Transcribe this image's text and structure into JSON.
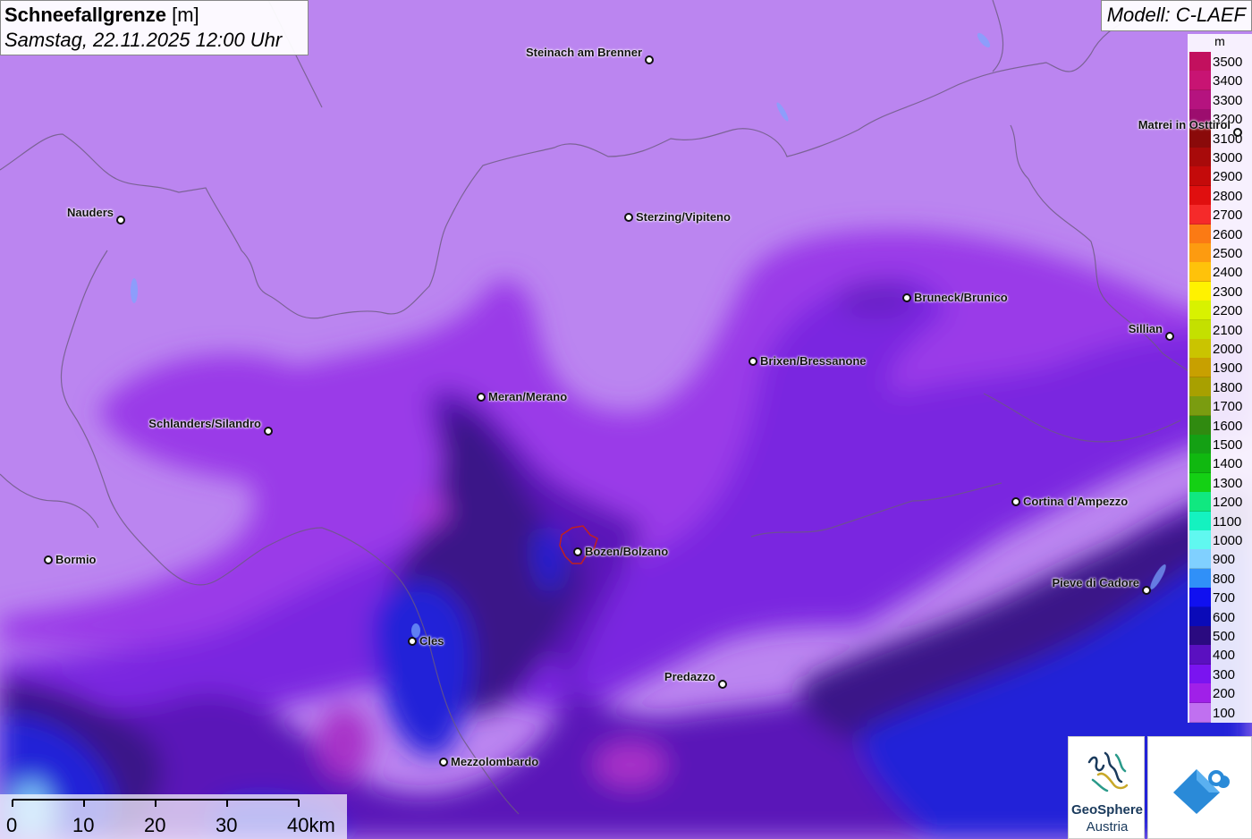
{
  "title": {
    "main": "Schneefallgrenze",
    "unit": "[m]",
    "subtitle": "Samstag, 22.11.2025 12:00 Uhr"
  },
  "model": "Modell: C-LAEF",
  "legend": {
    "unit": "m",
    "items": [
      {
        "label": "3500",
        "color": "#c2105e"
      },
      {
        "label": "3400",
        "color": "#c81473"
      },
      {
        "label": "3300",
        "color": "#b5137f"
      },
      {
        "label": "3200",
        "color": "#9c0d6e"
      },
      {
        "label": "3100",
        "color": "#8a0a0a"
      },
      {
        "label": "3000",
        "color": "#a80a0a"
      },
      {
        "label": "2900",
        "color": "#c40a0a"
      },
      {
        "label": "2800",
        "color": "#e00f0f"
      },
      {
        "label": "2700",
        "color": "#f52a2a"
      },
      {
        "label": "2600",
        "color": "#fb7a14"
      },
      {
        "label": "2500",
        "color": "#fd9b10"
      },
      {
        "label": "2400",
        "color": "#ffc20a"
      },
      {
        "label": "2300",
        "color": "#fff200"
      },
      {
        "label": "2200",
        "color": "#d8f200"
      },
      {
        "label": "2100",
        "color": "#c4e000"
      },
      {
        "label": "2000",
        "color": "#cac400"
      },
      {
        "label": "1900",
        "color": "#c8a000"
      },
      {
        "label": "1800",
        "color": "#a8a000"
      },
      {
        "label": "1700",
        "color": "#7a9c10"
      },
      {
        "label": "1600",
        "color": "#308a10"
      },
      {
        "label": "1500",
        "color": "#14a014"
      },
      {
        "label": "1400",
        "color": "#10b810"
      },
      {
        "label": "1300",
        "color": "#14d014"
      },
      {
        "label": "1200",
        "color": "#10e880"
      },
      {
        "label": "1100",
        "color": "#14f2c0"
      },
      {
        "label": "1000",
        "color": "#60f8f0"
      },
      {
        "label": "900",
        "color": "#80d0ff"
      },
      {
        "label": "800",
        "color": "#3090f8"
      },
      {
        "label": "700",
        "color": "#1010f0"
      },
      {
        "label": "600",
        "color": "#0a0ab8"
      },
      {
        "label": "500",
        "color": "#2a0a80"
      },
      {
        "label": "400",
        "color": "#5a10c0"
      },
      {
        "label": "300",
        "color": "#7a14f0"
      },
      {
        "label": "200",
        "color": "#a020e8"
      },
      {
        "label": "100",
        "color": "#c070f0"
      }
    ]
  },
  "cities": [
    {
      "name": "Steinach am Brenner",
      "side": "left"
    },
    {
      "name": "Matrei in Osttirol",
      "side": "left"
    },
    {
      "name": "Nauders",
      "side": "left"
    },
    {
      "name": "Sterzing/Vipiteno",
      "side": "right"
    },
    {
      "name": "Bruneck/Brunico",
      "side": "right"
    },
    {
      "name": "Sillian",
      "side": "left"
    },
    {
      "name": "Brixen/Bressanone",
      "side": "right"
    },
    {
      "name": "Meran/Merano",
      "side": "right"
    },
    {
      "name": "Schlanders/Silandro",
      "side": "left"
    },
    {
      "name": "Cortina d'Ampezzo",
      "side": "right"
    },
    {
      "name": "Bozen/Bolzano",
      "side": "right"
    },
    {
      "name": "Bormio",
      "side": "right"
    },
    {
      "name": "Pieve di Cadore",
      "side": "left"
    },
    {
      "name": "Cles",
      "side": "right"
    },
    {
      "name": "Predazzo",
      "side": "left"
    },
    {
      "name": "Mezzolombardo",
      "side": "right"
    }
  ],
  "scale": {
    "labels": [
      "0",
      "10",
      "20",
      "30",
      "40km"
    ]
  },
  "logo": {
    "name_line1": "GeoSphere",
    "name_line2": "Austria"
  },
  "icons": [
    "geosphere-logo-icon",
    "partner-logo-icon"
  ]
}
